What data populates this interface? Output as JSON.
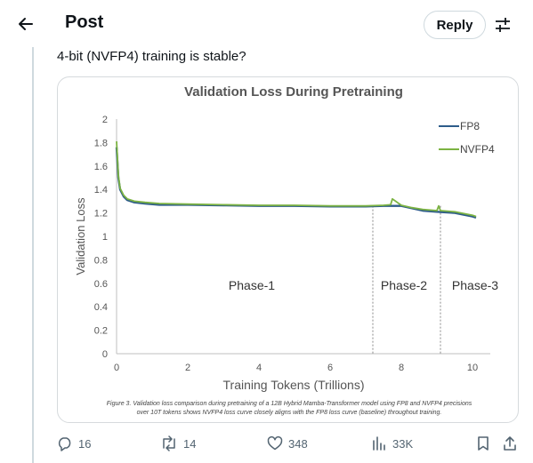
{
  "header": {
    "title": "Post",
    "reply_label": "Reply",
    "back_icon": "arrow-left-icon",
    "settings_icon": "sliders-icon"
  },
  "post": {
    "text": "4-bit (NVFP4) training is stable?"
  },
  "figure": {
    "caption_line1": "Figure 3. Validation loss comparison during pretraining of a 12B Hybrid Mamba-Transformer model using FP8 and NVFP4 precisions",
    "caption_line2": "over 10T tokens shows NVFP4 loss curve closely aligns with the FP8 loss curve (baseline) throughout training.",
    "phases": [
      "Phase-1",
      "Phase-2",
      "Phase-3"
    ],
    "phase_boundaries": [
      7.2,
      9.1
    ]
  },
  "chart_data": {
    "type": "line",
    "title": "Validation Loss During Pretraining",
    "xlabel": "Training Tokens (Trillions)",
    "ylabel": "Validation Loss",
    "xlim": [
      0,
      10.5
    ],
    "ylim": [
      0,
      2
    ],
    "xticks": [
      "0",
      "2",
      "4",
      "6",
      "8",
      "10"
    ],
    "yticks": [
      "0",
      "0.2",
      "0.4",
      "0.6",
      "0.8",
      "1",
      "1.2",
      "1.4",
      "1.6",
      "1.8",
      "2"
    ],
    "legend_position": "top-right",
    "series": [
      {
        "name": "FP8",
        "color": "#2e5c8a",
        "x": [
          0,
          0.05,
          0.1,
          0.2,
          0.3,
          0.5,
          0.8,
          1.2,
          2,
          3,
          4,
          5,
          6,
          7,
          7.5,
          8,
          8.3,
          8.6,
          9,
          9.5,
          10,
          10.1
        ],
        "y": [
          1.76,
          1.5,
          1.4,
          1.34,
          1.31,
          1.29,
          1.28,
          1.27,
          1.27,
          1.265,
          1.26,
          1.26,
          1.255,
          1.255,
          1.26,
          1.26,
          1.24,
          1.22,
          1.21,
          1.2,
          1.17,
          1.16
        ]
      },
      {
        "name": "NVFP4",
        "color": "#7cb342",
        "x": [
          0,
          0.05,
          0.1,
          0.2,
          0.3,
          0.5,
          0.8,
          1.2,
          2,
          3,
          4,
          5,
          6,
          7,
          7.5,
          7.7,
          7.75,
          8,
          8.3,
          8.6,
          9,
          9.05,
          9.1,
          9.5,
          10,
          10.1
        ],
        "y": [
          1.81,
          1.52,
          1.41,
          1.35,
          1.32,
          1.3,
          1.29,
          1.28,
          1.275,
          1.27,
          1.265,
          1.265,
          1.26,
          1.26,
          1.265,
          1.27,
          1.32,
          1.265,
          1.245,
          1.23,
          1.22,
          1.26,
          1.22,
          1.21,
          1.18,
          1.17
        ]
      }
    ]
  },
  "actions": {
    "replies": "16",
    "reposts": "14",
    "likes": "348",
    "views": "33K",
    "reply_icon": "comment-icon",
    "repost_icon": "repost-icon",
    "like_icon": "heart-icon",
    "views_icon": "bar-chart-icon",
    "bookmark_icon": "bookmark-icon",
    "share_icon": "share-icon"
  }
}
